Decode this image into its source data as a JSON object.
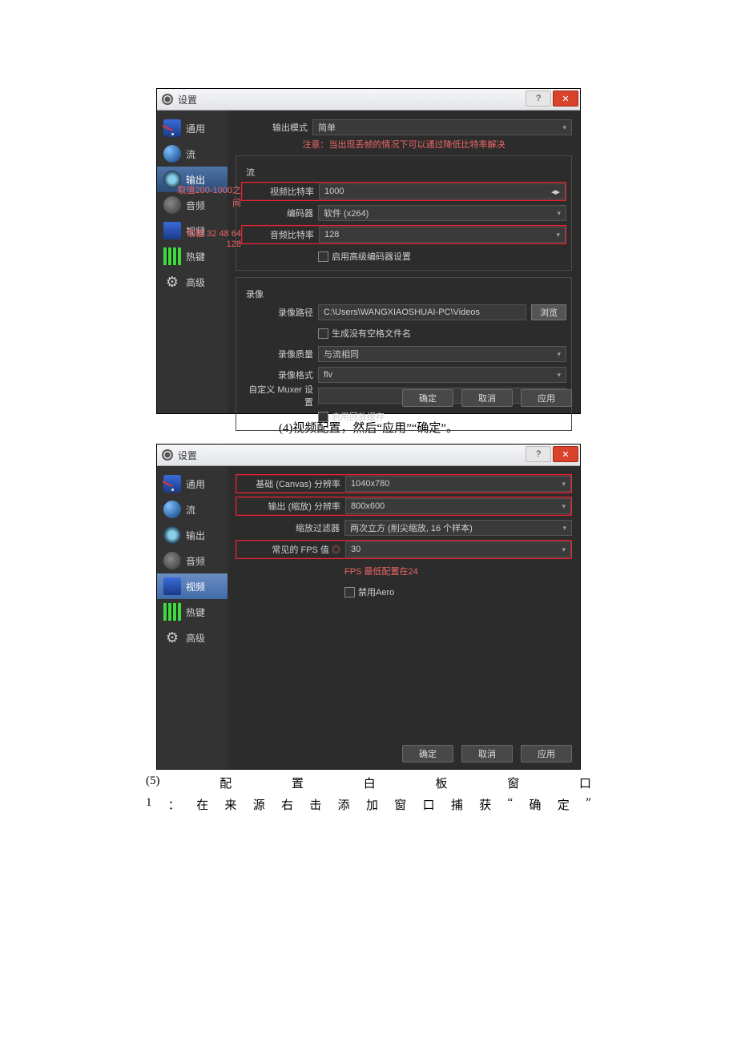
{
  "window1": {
    "title": "设置",
    "sidebar": [
      {
        "label": "通用"
      },
      {
        "label": "流"
      },
      {
        "label": "输出"
      },
      {
        "label": "音频"
      },
      {
        "label": "视频"
      },
      {
        "label": "热键"
      },
      {
        "label": "高级"
      }
    ],
    "output_mode_label": "输出模式",
    "output_mode_value": "简单",
    "warning": "注意：当出现丢帧的情况下可以通过降低比特率解决",
    "stream_section": "流",
    "hint_video_rate": "取值200-1000之间",
    "video_bitrate_label": "视频比特率",
    "video_bitrate_value": "1000",
    "encoder_label": "编码器",
    "encoder_value": "软件 (x264)",
    "hint_audio_rate": "取值 32 48 64 128",
    "audio_bitrate_label": "音频比特率",
    "audio_bitrate_value": "128",
    "enable_adv_encoder": "启用高级编码器设置",
    "record_section": "录像",
    "record_path_label": "录像路径",
    "record_path_value": "C:\\Users\\WANGXIAOSHUAI-PC\\Videos",
    "browse": "浏览",
    "gen_no_space": "生成没有空格文件名",
    "record_quality_label": "录像质量",
    "record_quality_value": "与流相同",
    "record_format_label": "录像格式",
    "record_format_value": "flv",
    "muxer_label": "自定义 Muxer 设置",
    "enable_replay": "启用回放缓存",
    "ok": "确定",
    "cancel": "取消",
    "apply": "应用"
  },
  "caption4": "(4)视频配置，然后“应用”“确定”。",
  "window2": {
    "title": "设置",
    "sidebar": [
      {
        "label": "通用"
      },
      {
        "label": "流"
      },
      {
        "label": "输出"
      },
      {
        "label": "音频"
      },
      {
        "label": "视频"
      },
      {
        "label": "热键"
      },
      {
        "label": "高级"
      }
    ],
    "base_res_label": "基础 (Canvas) 分辨率",
    "base_res_value": "1040x780",
    "out_res_label": "输出 (缩放) 分辨率",
    "out_res_value": "800x600",
    "filter_label": "缩放过滤器",
    "filter_value": "两次立方 (削尖缩放, 16 个样本)",
    "fps_label": "常见的 FPS 值",
    "fps_indicator": "◎",
    "fps_value": "30",
    "fps_note": "FPS 最低配置在24",
    "disable_aero": "禁用Aero",
    "ok": "确定",
    "cancel": "取消",
    "apply": "应用"
  },
  "caption5_line1": [
    "(5)",
    "配",
    "置",
    "白",
    "板",
    "窗",
    "口"
  ],
  "caption5_line2": [
    "1",
    "：",
    "在",
    "来",
    "源",
    "右",
    "击",
    "添",
    "加",
    "窗",
    "口",
    "捕",
    "获",
    "“",
    "确",
    "定",
    "”"
  ]
}
